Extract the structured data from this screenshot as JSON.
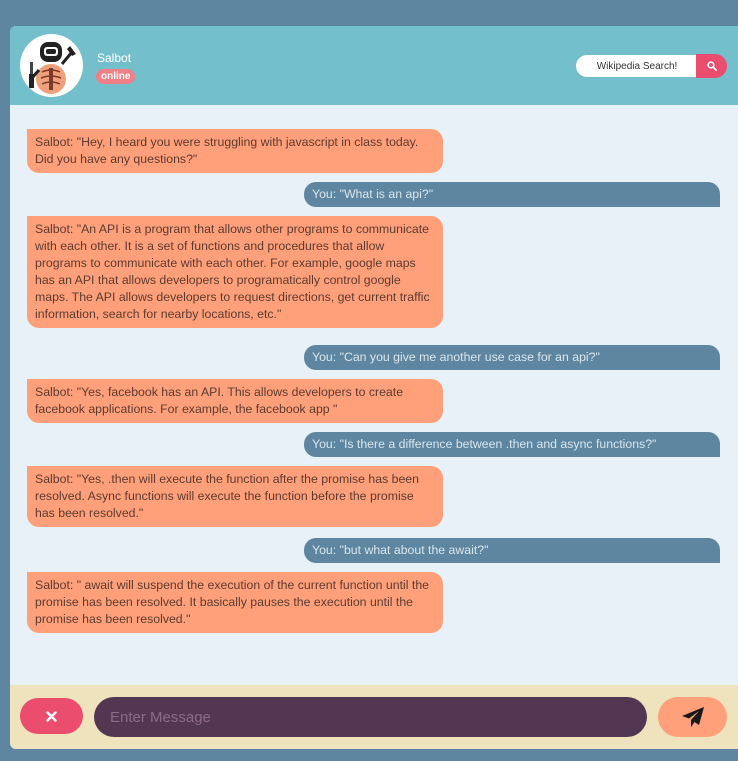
{
  "header": {
    "bot_name": "Salbot",
    "status": "online",
    "search_placeholder": "Wikipedia Search!",
    "avatar_icon": "robot-chef-avatar",
    "search_icon": "search-icon"
  },
  "messages": [
    {
      "sender": "bot",
      "text": "Salbot: \"Hey, I heard you were struggling with javascript in class today. Did you have any questions?\""
    },
    {
      "sender": "user",
      "text": "You: \"What is an api?\""
    },
    {
      "sender": "bot",
      "text": "Salbot: \"An API is a program that allows other programs to communicate with each other. It is a set of functions and procedures that allow programs to communicate with each other. For example, google maps has an API that allows developers to programatically control google maps. The API allows developers to request directions, get current traffic information, search for nearby locations, etc.\""
    },
    {
      "sender": "user",
      "text": "You: \"Can you give me another use case for an api?\""
    },
    {
      "sender": "bot",
      "text": "Salbot: \"Yes, facebook has an API. This allows developers to create facebook applications. For example, the facebook app \""
    },
    {
      "sender": "user",
      "text": "You: \"Is there a difference between .then and async functions?\""
    },
    {
      "sender": "bot",
      "text": "Salbot: \"Yes, .then will execute the function after the promise has been resolved. Async functions will execute the function before the promise has been resolved.\""
    },
    {
      "sender": "user",
      "text": "You: \"but what about the await?\""
    },
    {
      "sender": "bot",
      "text": "Salbot: \" await will suspend the execution of the current function until the promise has been resolved. It basically pauses the execution until the promise has been resolved.\""
    }
  ],
  "footer": {
    "input_placeholder": "Enter Message",
    "input_value": "",
    "clear_icon": "close-icon",
    "send_icon": "paper-plane-icon"
  },
  "colors": {
    "page_background": "#5e86a0",
    "header": "#74bfcc",
    "chat_background": "#e8f1f8",
    "bot_bubble": "#ffa07a",
    "user_bubble": "#5e86a0",
    "footer": "#efe3bd",
    "accent_pink": "#ea4d6e",
    "input_background": "#533652"
  }
}
